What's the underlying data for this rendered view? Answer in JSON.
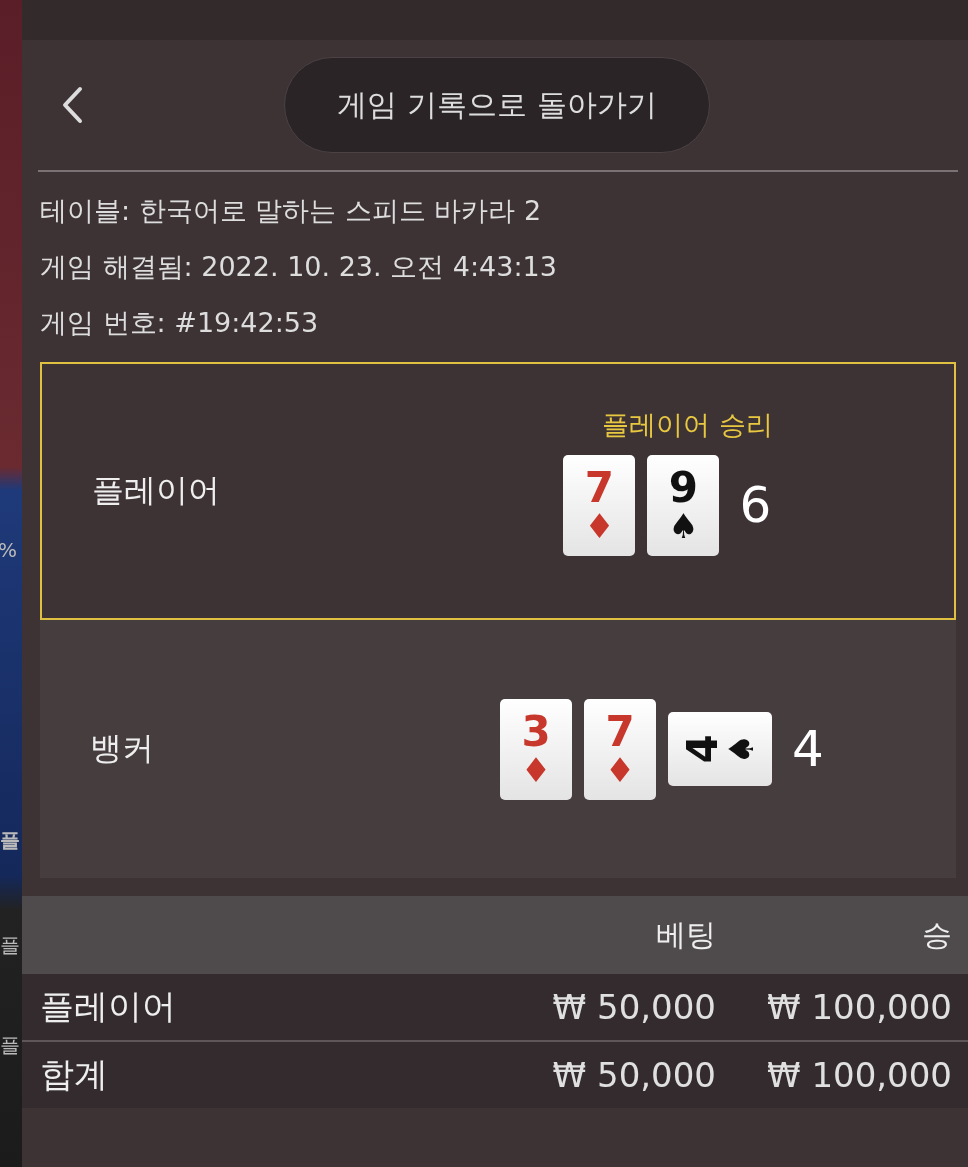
{
  "background_strip": {
    "texts": [
      {
        "text": "%",
        "kind": "small"
      },
      {
        "text": "플",
        "kind": "large"
      },
      {
        "text": "플",
        "kind": "small"
      },
      {
        "text": "플",
        "kind": "small"
      }
    ]
  },
  "back_button": {
    "label": "게임 기록으로 돌아가기"
  },
  "info": [
    "테이블: 한국어로 말하는 스피드 바카라 2",
    "게임 해결됨: 2022. 10. 23. 오전 4:43:13",
    "게임 번호: #19:42:53"
  ],
  "hands": [
    {
      "name": "플레이어",
      "winner": true,
      "result": "플레이어 승리",
      "total": "6",
      "cards": [
        {
          "rank": "7",
          "suit": "♦",
          "color": "#c8372c",
          "kind": "upright"
        },
        {
          "rank": "9",
          "suit": "♠",
          "color": "#111111",
          "kind": "upright"
        }
      ]
    },
    {
      "name": "뱅커",
      "winner": false,
      "total": "4",
      "cards": [
        {
          "rank": "3",
          "suit": "♦",
          "color": "#c8372c",
          "kind": "upright"
        },
        {
          "rank": "7",
          "suit": "♦",
          "color": "#c8372c",
          "kind": "upright"
        },
        {
          "rank": "4",
          "suit": "♠",
          "color": "#111111",
          "kind": "sideways"
        }
      ]
    }
  ],
  "bets_table": {
    "columns": [
      "베팅",
      "승"
    ],
    "rows": [
      {
        "label": "플레이어",
        "bet": "₩ 50,000",
        "win": "₩ 100,000"
      },
      {
        "label": "합계",
        "bet": "₩ 50,000",
        "win": "₩ 100,000"
      }
    ]
  }
}
